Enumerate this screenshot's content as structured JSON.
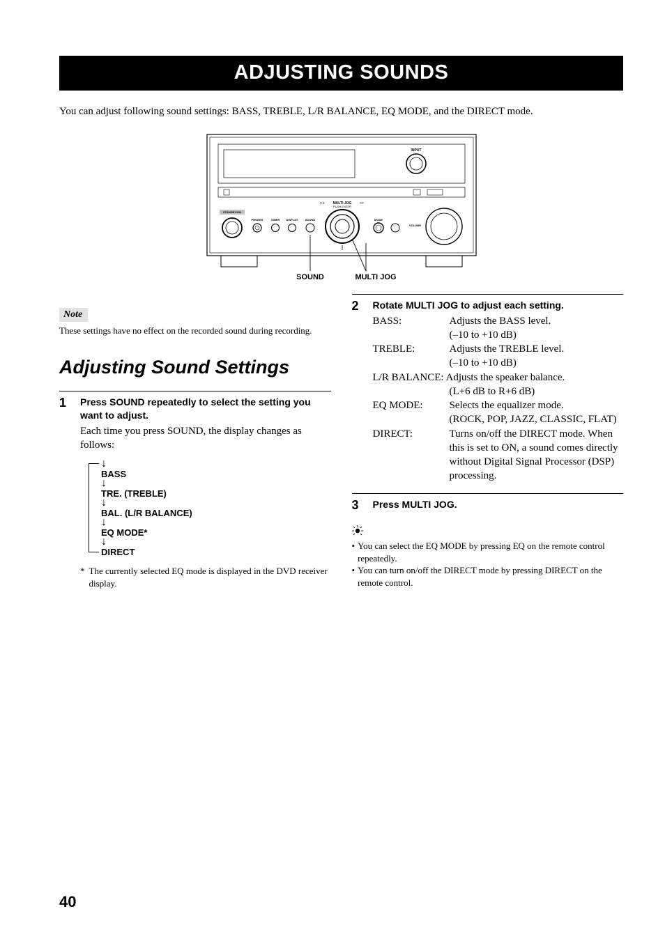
{
  "title": "ADJUSTING SOUNDS",
  "intro": "You can adjust following sound settings: BASS, TREBLE, L/R BALANCE, EQ MODE, and the DIRECT mode.",
  "diagram": {
    "sound_label": "SOUND",
    "multijog_label": "MULTI JOG",
    "input_label": "INPUT",
    "standby_label": "STANDBY/ON",
    "phones_label": "PHONES",
    "timer_label": "TIMER",
    "display_label": "DISPLAY",
    "sound_btn_label": "SOUND",
    "mode_label": "MODE",
    "volume_label": "VOLUME",
    "mj_header": "MULTI JOG",
    "mj_sub": "PUSH-ENTER"
  },
  "note_tag": "Note",
  "note_text": "These settings have no effect on the recorded sound during recording.",
  "section_heading": "Adjusting Sound Settings",
  "steps": {
    "s1": {
      "num": "1",
      "head": "Press SOUND repeatedly to select the setting you want to adjust.",
      "text": "Each time you press SOUND, the display changes as follows:",
      "flow": [
        "BASS",
        "TRE. (TREBLE)",
        "BAL. (L/R BALANCE)",
        "EQ MODE*",
        "DIRECT"
      ],
      "footnote_mark": "*",
      "footnote": "The currently selected EQ mode is displayed in the DVD receiver display."
    },
    "s2": {
      "num": "2",
      "head": "Rotate MULTI JOG to adjust each setting.",
      "defs": {
        "bass_k": "BASS:",
        "bass_v1": "Adjusts the BASS level.",
        "bass_v2": "(–10 to +10 dB)",
        "treble_k": "TREBLE:",
        "treble_v1": "Adjusts the TREBLE level.",
        "treble_v2": "(–10 to +10 dB)",
        "lr_full": "L/R BALANCE: Adjusts the speaker balance.",
        "lr_v2": "(L+6 dB to R+6 dB)",
        "eq_k": "EQ MODE:",
        "eq_v1": "Selects the equalizer mode.",
        "eq_v2": "(ROCK, POP, JAZZ, CLASSIC, FLAT)",
        "direct_k": "DIRECT:",
        "direct_v1": "Turns on/off the DIRECT mode. When this is set to ON, a sound comes directly without Digital Signal Processor (DSP) processing."
      }
    },
    "s3": {
      "num": "3",
      "head": "Press MULTI JOG."
    }
  },
  "tips": {
    "t1": "You can select the EQ MODE by pressing EQ on the remote control repeatedly.",
    "t2": "You can turn on/off the DIRECT mode by pressing DIRECT on the remote control."
  },
  "page_number": "40"
}
